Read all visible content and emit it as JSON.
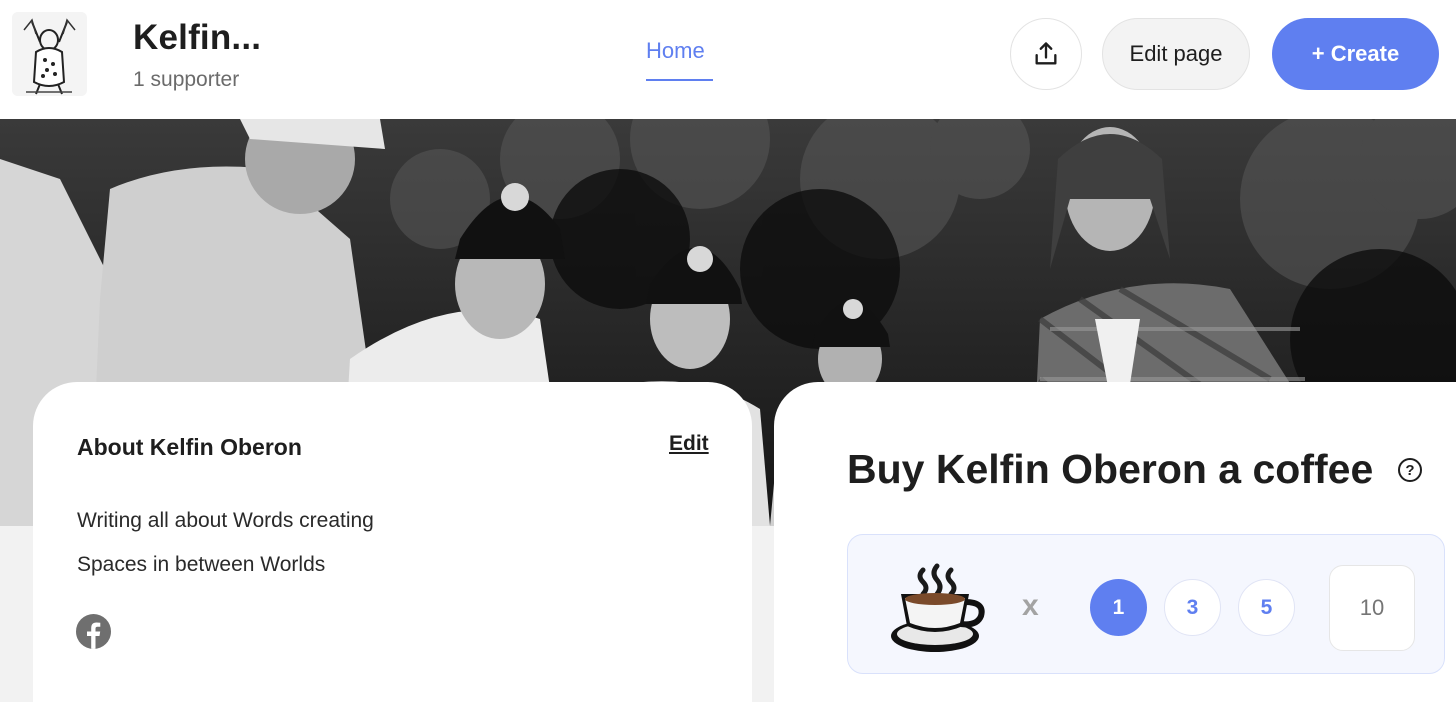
{
  "header": {
    "title": "Kelfin...",
    "supporters": "1 supporter",
    "nav": {
      "home_label": "Home"
    },
    "buttons": {
      "edit_page": "Edit page",
      "create": "+ Create"
    },
    "accent_color": "#5f7ff0"
  },
  "about": {
    "title": "About Kelfin Oberon",
    "edit_label": "Edit",
    "lines": [
      "Writing all about Words creating",
      "Spaces in between Worlds"
    ],
    "social_icon": "facebook-icon"
  },
  "coffee": {
    "title": "Buy Kelfin Oberon a coffee",
    "help_icon": "question-circle-icon",
    "multiplier": "x",
    "amounts": [
      "1",
      "3",
      "5"
    ],
    "selected_amount": "1",
    "custom_placeholder": "10"
  }
}
